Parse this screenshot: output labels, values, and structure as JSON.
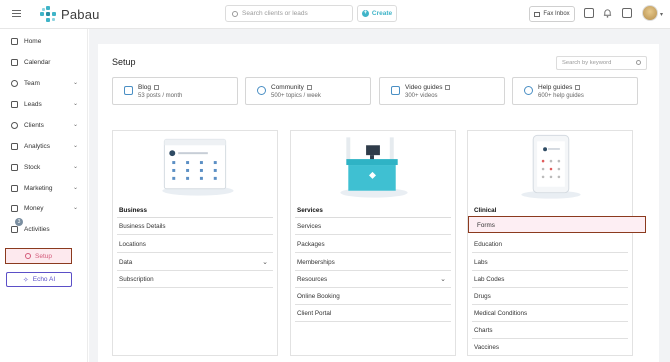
{
  "header": {
    "app_name": "Pabau",
    "search_placeholder": "Search clients or leads",
    "create_label": "Create",
    "fax_label": "Fax Inbox"
  },
  "sidebar": {
    "items": [
      {
        "label": "Home",
        "icon": "home-icon",
        "expandable": false
      },
      {
        "label": "Calendar",
        "icon": "calendar-icon",
        "expandable": false
      },
      {
        "label": "Team",
        "icon": "team-icon",
        "expandable": true
      },
      {
        "label": "Leads",
        "icon": "leads-icon",
        "expandable": true
      },
      {
        "label": "Clients",
        "icon": "clients-icon",
        "expandable": true
      },
      {
        "label": "Analytics",
        "icon": "analytics-icon",
        "expandable": true
      },
      {
        "label": "Stock",
        "icon": "stock-icon",
        "expandable": true
      },
      {
        "label": "Marketing",
        "icon": "marketing-icon",
        "expandable": true
      },
      {
        "label": "Money",
        "icon": "money-icon",
        "expandable": true
      },
      {
        "label": "Activities",
        "icon": "activities-icon",
        "expandable": false
      }
    ],
    "activities_badge": "3",
    "setup_label": "Setup",
    "echo_label": "Echo AI"
  },
  "page": {
    "title": "Setup",
    "search_placeholder": "Search by keyword"
  },
  "resources": [
    {
      "title": "Blog",
      "subtitle": "53 posts / month",
      "icon": "blog-icon"
    },
    {
      "title": "Community",
      "subtitle": "500+ topics / week",
      "icon": "community-icon"
    },
    {
      "title": "Video guides",
      "subtitle": "300+ videos",
      "icon": "video-icon"
    },
    {
      "title": "Help guides",
      "subtitle": "600+ help guides",
      "icon": "help-icon"
    }
  ],
  "columns": [
    {
      "heading": "Business",
      "items": [
        {
          "label": "Business Details",
          "expandable": false
        },
        {
          "label": "Locations",
          "expandable": false
        },
        {
          "label": "Data",
          "expandable": true
        },
        {
          "label": "Subscription",
          "expandable": false
        }
      ]
    },
    {
      "heading": "Services",
      "items": [
        {
          "label": "Services",
          "expandable": false
        },
        {
          "label": "Packages",
          "expandable": false
        },
        {
          "label": "Memberships",
          "expandable": false
        },
        {
          "label": "Resources",
          "expandable": true
        },
        {
          "label": "Online Booking",
          "expandable": false
        },
        {
          "label": "Client Portal",
          "expandable": false
        }
      ]
    },
    {
      "heading": "Clinical",
      "items": [
        {
          "label": "Forms",
          "expandable": false
        },
        {
          "label": "Education",
          "expandable": false
        },
        {
          "label": "Labs",
          "expandable": false
        },
        {
          "label": "Lab Codes",
          "expandable": false
        },
        {
          "label": "Drugs",
          "expandable": false
        },
        {
          "label": "Medical Conditions",
          "expandable": false
        },
        {
          "label": "Charts",
          "expandable": false
        },
        {
          "label": "Vaccines",
          "expandable": false
        }
      ]
    }
  ],
  "colors": {
    "brand": "#3fb4c8",
    "setup_highlight_border": "#8b3a1e",
    "setup_text": "#d35a7a",
    "echo": "#5b4fc7"
  }
}
